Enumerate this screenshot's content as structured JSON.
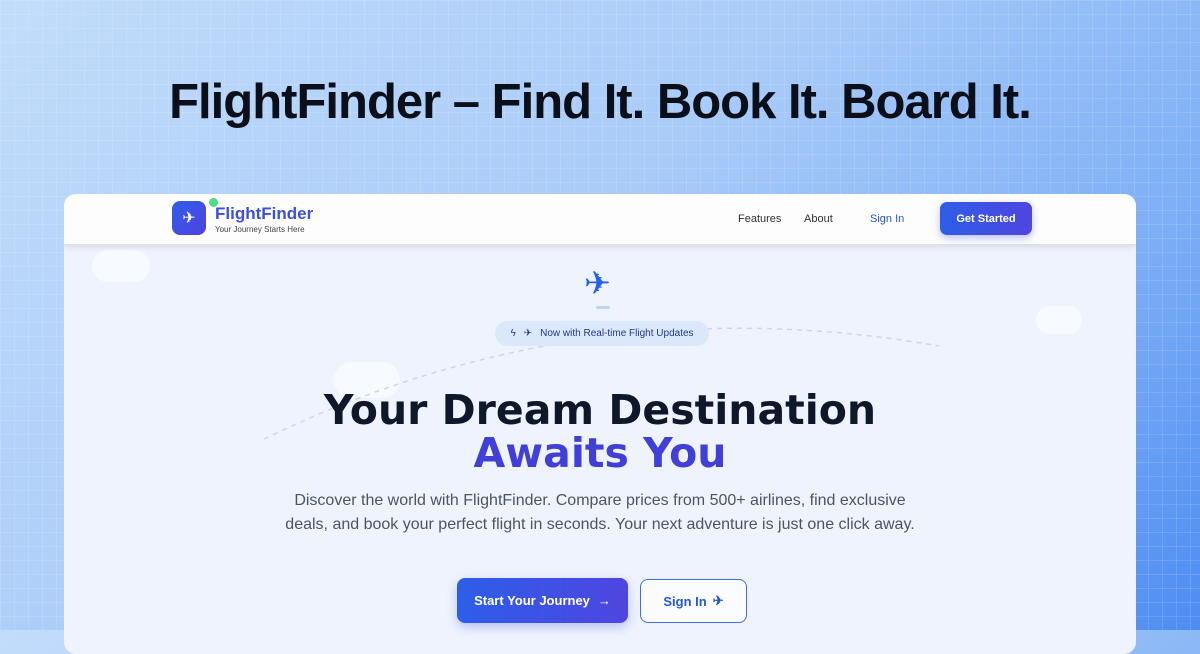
{
  "headline": "FlightFinder – Find It. Book It. Board It.",
  "nav": {
    "brand": "FlightFinder",
    "tagline": "Your Journey Starts Here",
    "links": [
      "Features",
      "About"
    ],
    "sign_in": "Sign In",
    "get_started": "Get Started"
  },
  "hero": {
    "badge": "Now with Real-time Flight Updates",
    "title_line1": "Your Dream Destination",
    "title_line2": "Awaits You",
    "description": "Discover the world with FlightFinder. Compare prices from 500+ airlines, find exclusive deals, and book your perfect flight in seconds. Your next adventure is just one click away.",
    "cta_primary": "Start Your Journey",
    "cta_secondary": "Sign In"
  },
  "colors": {
    "accent": "#3b4fe0",
    "primary": "#2d5ee8",
    "online": "#4ade80"
  }
}
